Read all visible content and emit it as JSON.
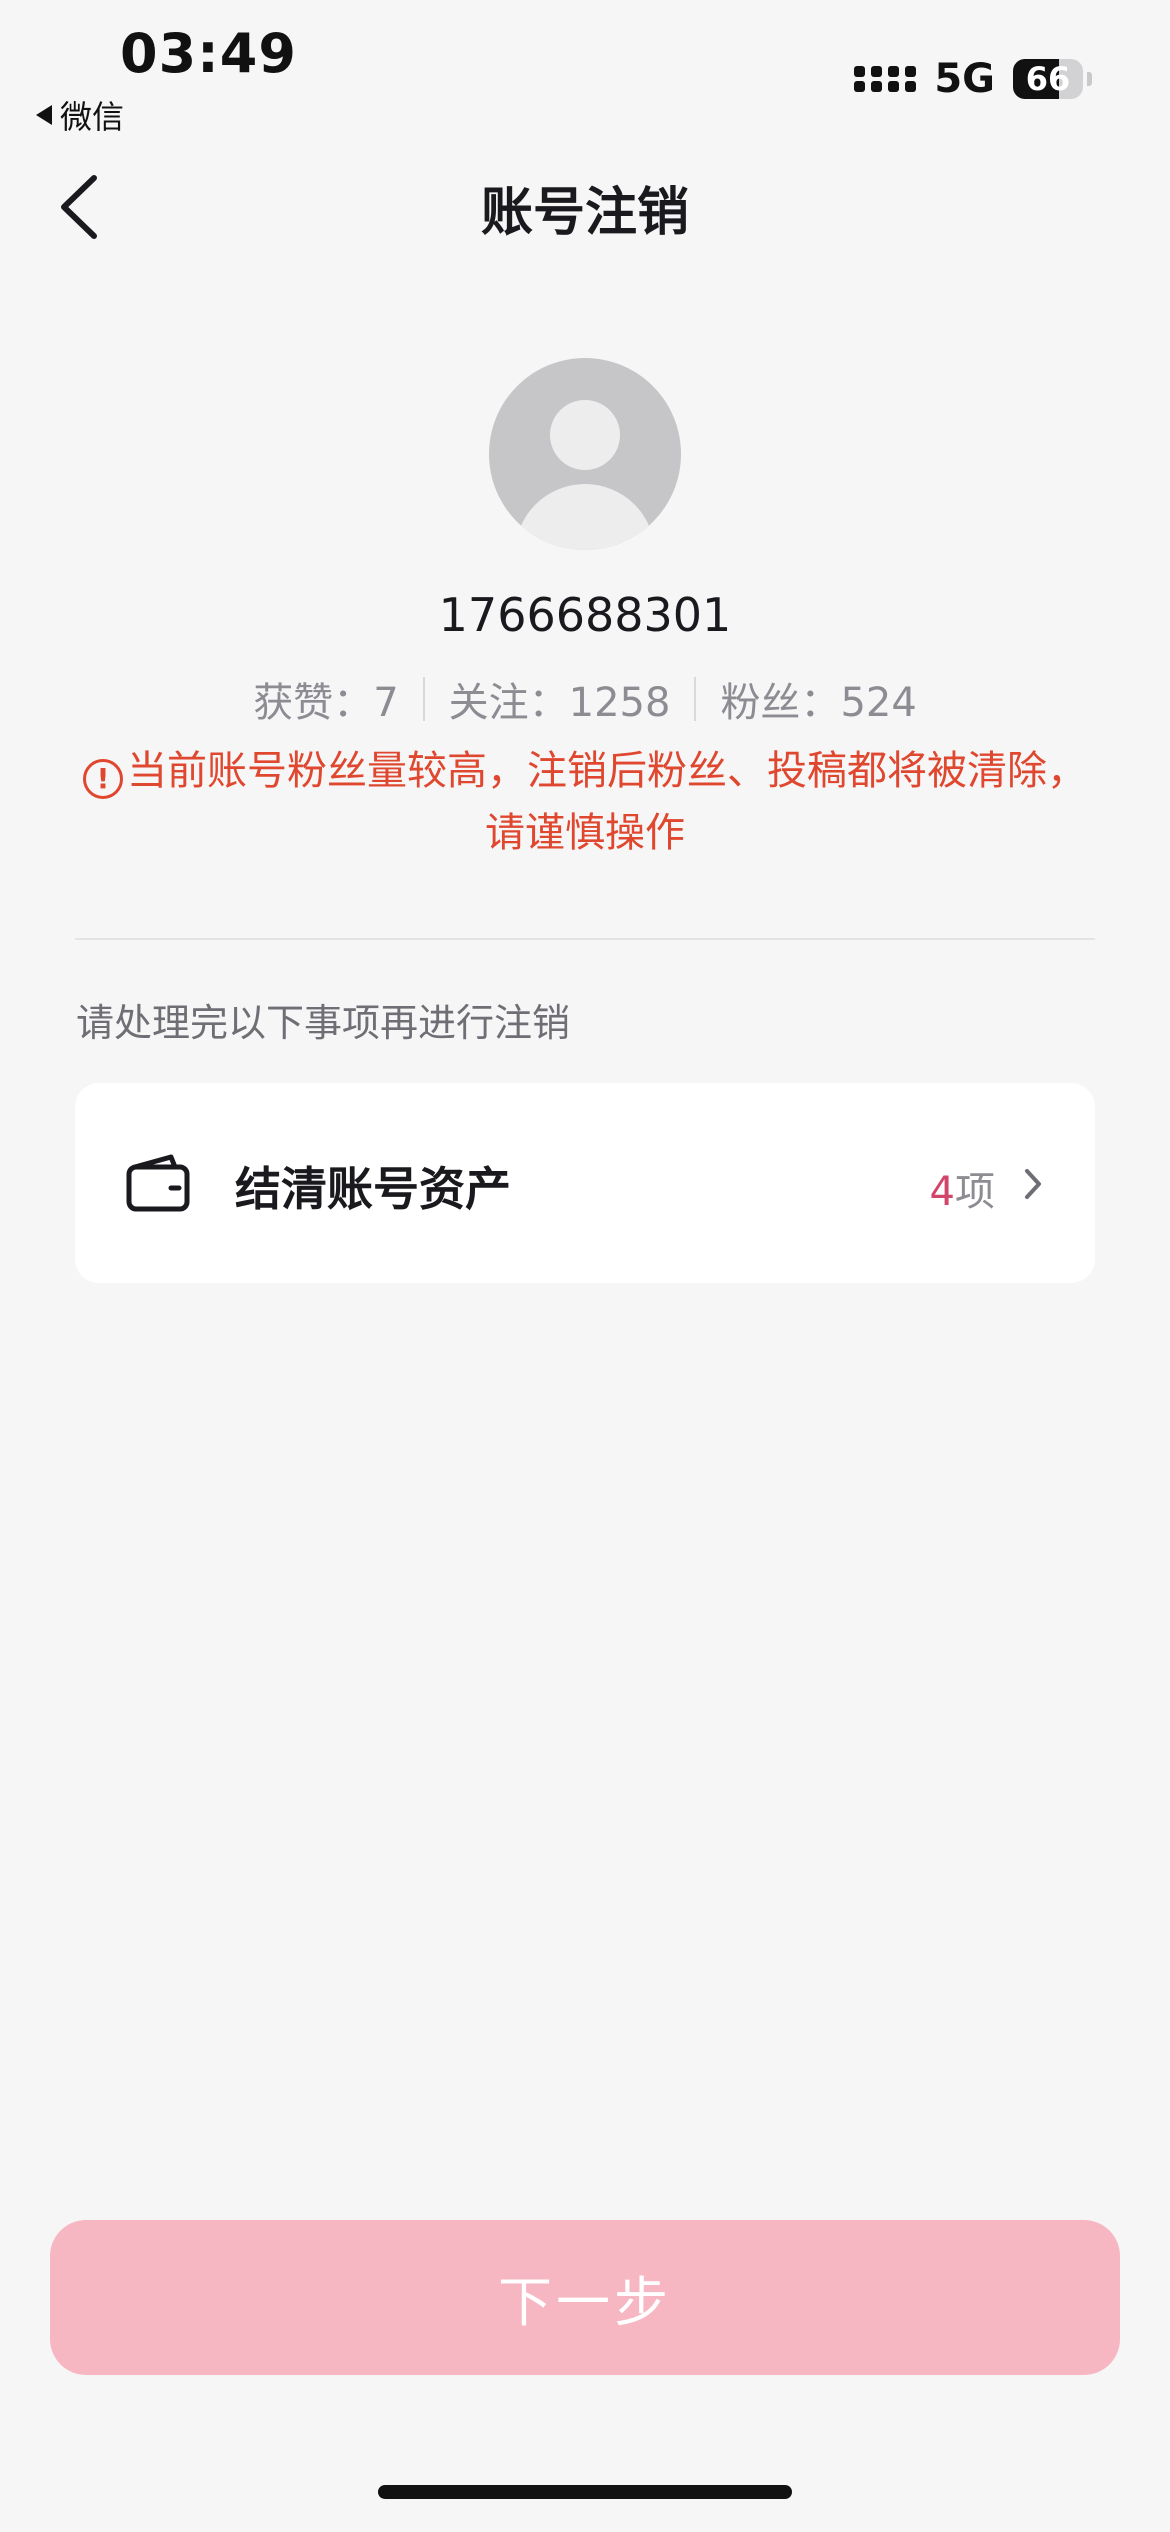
{
  "status_bar": {
    "time": "03:49",
    "back_app": "微信",
    "network": "5G",
    "battery_level": 66,
    "battery_text": "66"
  },
  "nav": {
    "title": "账号注销"
  },
  "profile": {
    "user_id": "1766688301",
    "stats": [
      {
        "label": "获赞：",
        "value": "7"
      },
      {
        "label": "关注：",
        "value": "1258"
      },
      {
        "label": "粉丝：",
        "value": "524"
      }
    ],
    "warning_icon_text": "!",
    "warning_text": "当前账号粉丝量较高，注销后粉丝、投稿都将被清除，请谨慎操作"
  },
  "section": {
    "label": "请处理完以下事项再进行注销"
  },
  "asset_item": {
    "icon": "wallet-icon",
    "label": "结清账号资产",
    "count": "4",
    "count_unit": "项"
  },
  "footer": {
    "next_label": "下一步"
  },
  "colors": {
    "warning": "#e0472f",
    "accent": "#d0456a",
    "button_disabled": "#f7b7c2",
    "background": "#f6f6f7"
  }
}
